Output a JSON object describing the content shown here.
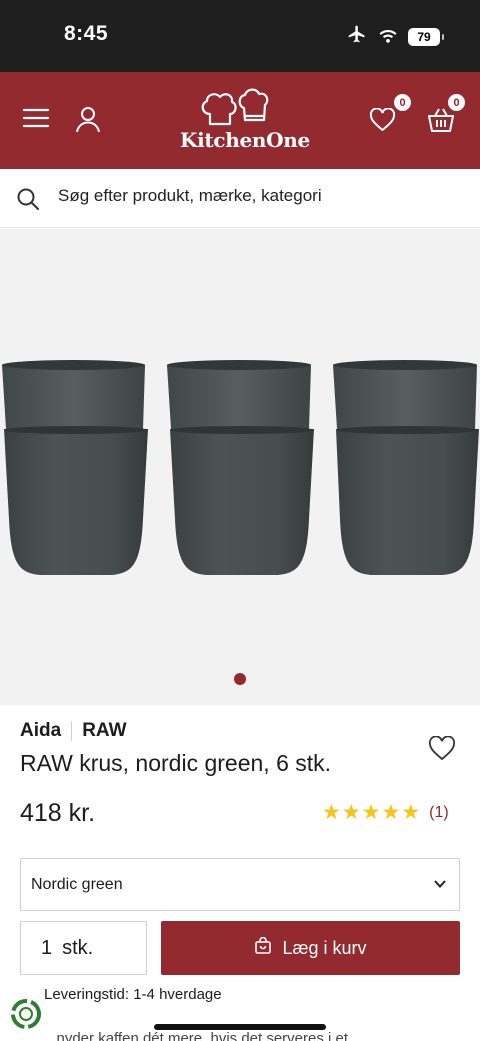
{
  "status_bar": {
    "time": "8:45",
    "battery": "79"
  },
  "header": {
    "logo_text": "KitchenOne",
    "wishlist_count": "0",
    "cart_count": "0",
    "icons": [
      "menu-icon",
      "user-icon",
      "heart-icon",
      "basket-icon"
    ],
    "accent_color": "#922a30"
  },
  "search": {
    "placeholder": "Søg efter produkt, mærke, kategori"
  },
  "product": {
    "brand": "Aida",
    "series": "RAW",
    "title": "RAW krus, nordic green, 6 stk.",
    "price": "418 kr.",
    "rating_stars": 5,
    "review_count": "(1)",
    "variant": "Nordic green",
    "quantity": "1",
    "quantity_unit": "stk.",
    "add_to_cart_label": "Læg i kurv",
    "delivery": "Leveringstid: 1-4 hverdage",
    "description_snippet": "...nyder kaffen dét mere, hvis det serveres i et"
  },
  "gallery": {
    "active_slide": 1,
    "slide_count": 1
  }
}
